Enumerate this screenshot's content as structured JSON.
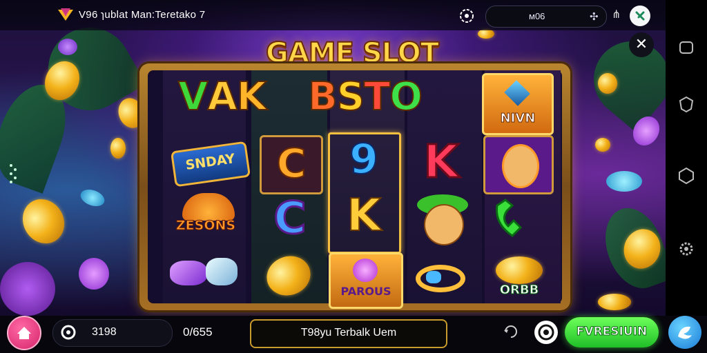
{
  "topbar": {
    "title": "V96 ɿublat Man:Teɾetako 7",
    "balance_display": "ᴍ06",
    "icons": [
      "brand-logo-icon",
      "settings-icon",
      "star-icon",
      "share-icon",
      "profile-icon"
    ]
  },
  "game": {
    "title": "GAME SLOT",
    "banner_letters": [
      "V",
      "A",
      "K",
      "B",
      "S",
      "T",
      "O"
    ],
    "winner_tile": "NIVN",
    "reels": [
      {
        "symbols": [
          "SNDAY",
          "ZESONS",
          "gems"
        ]
      },
      {
        "symbols": [
          "C",
          "C",
          "coin"
        ]
      },
      {
        "symbols": [
          "9",
          "K",
          "PAROUS"
        ]
      },
      {
        "symbols": [
          "K",
          "jungle-face",
          "ring"
        ]
      },
      {
        "symbols": [
          "NIVN",
          "hero-face",
          "phone",
          "ORBB"
        ]
      }
    ]
  },
  "bottombar": {
    "coins": "3198",
    "bet": "0/655",
    "ticker": "T98yu Terbalk Uem",
    "spin_label": "FVRESIUIN"
  },
  "colors": {
    "accent_gold": "#f5c040",
    "spin_green": "#2bd33a",
    "home_pink": "#e0337a",
    "auto_blue": "#2a8be6"
  }
}
